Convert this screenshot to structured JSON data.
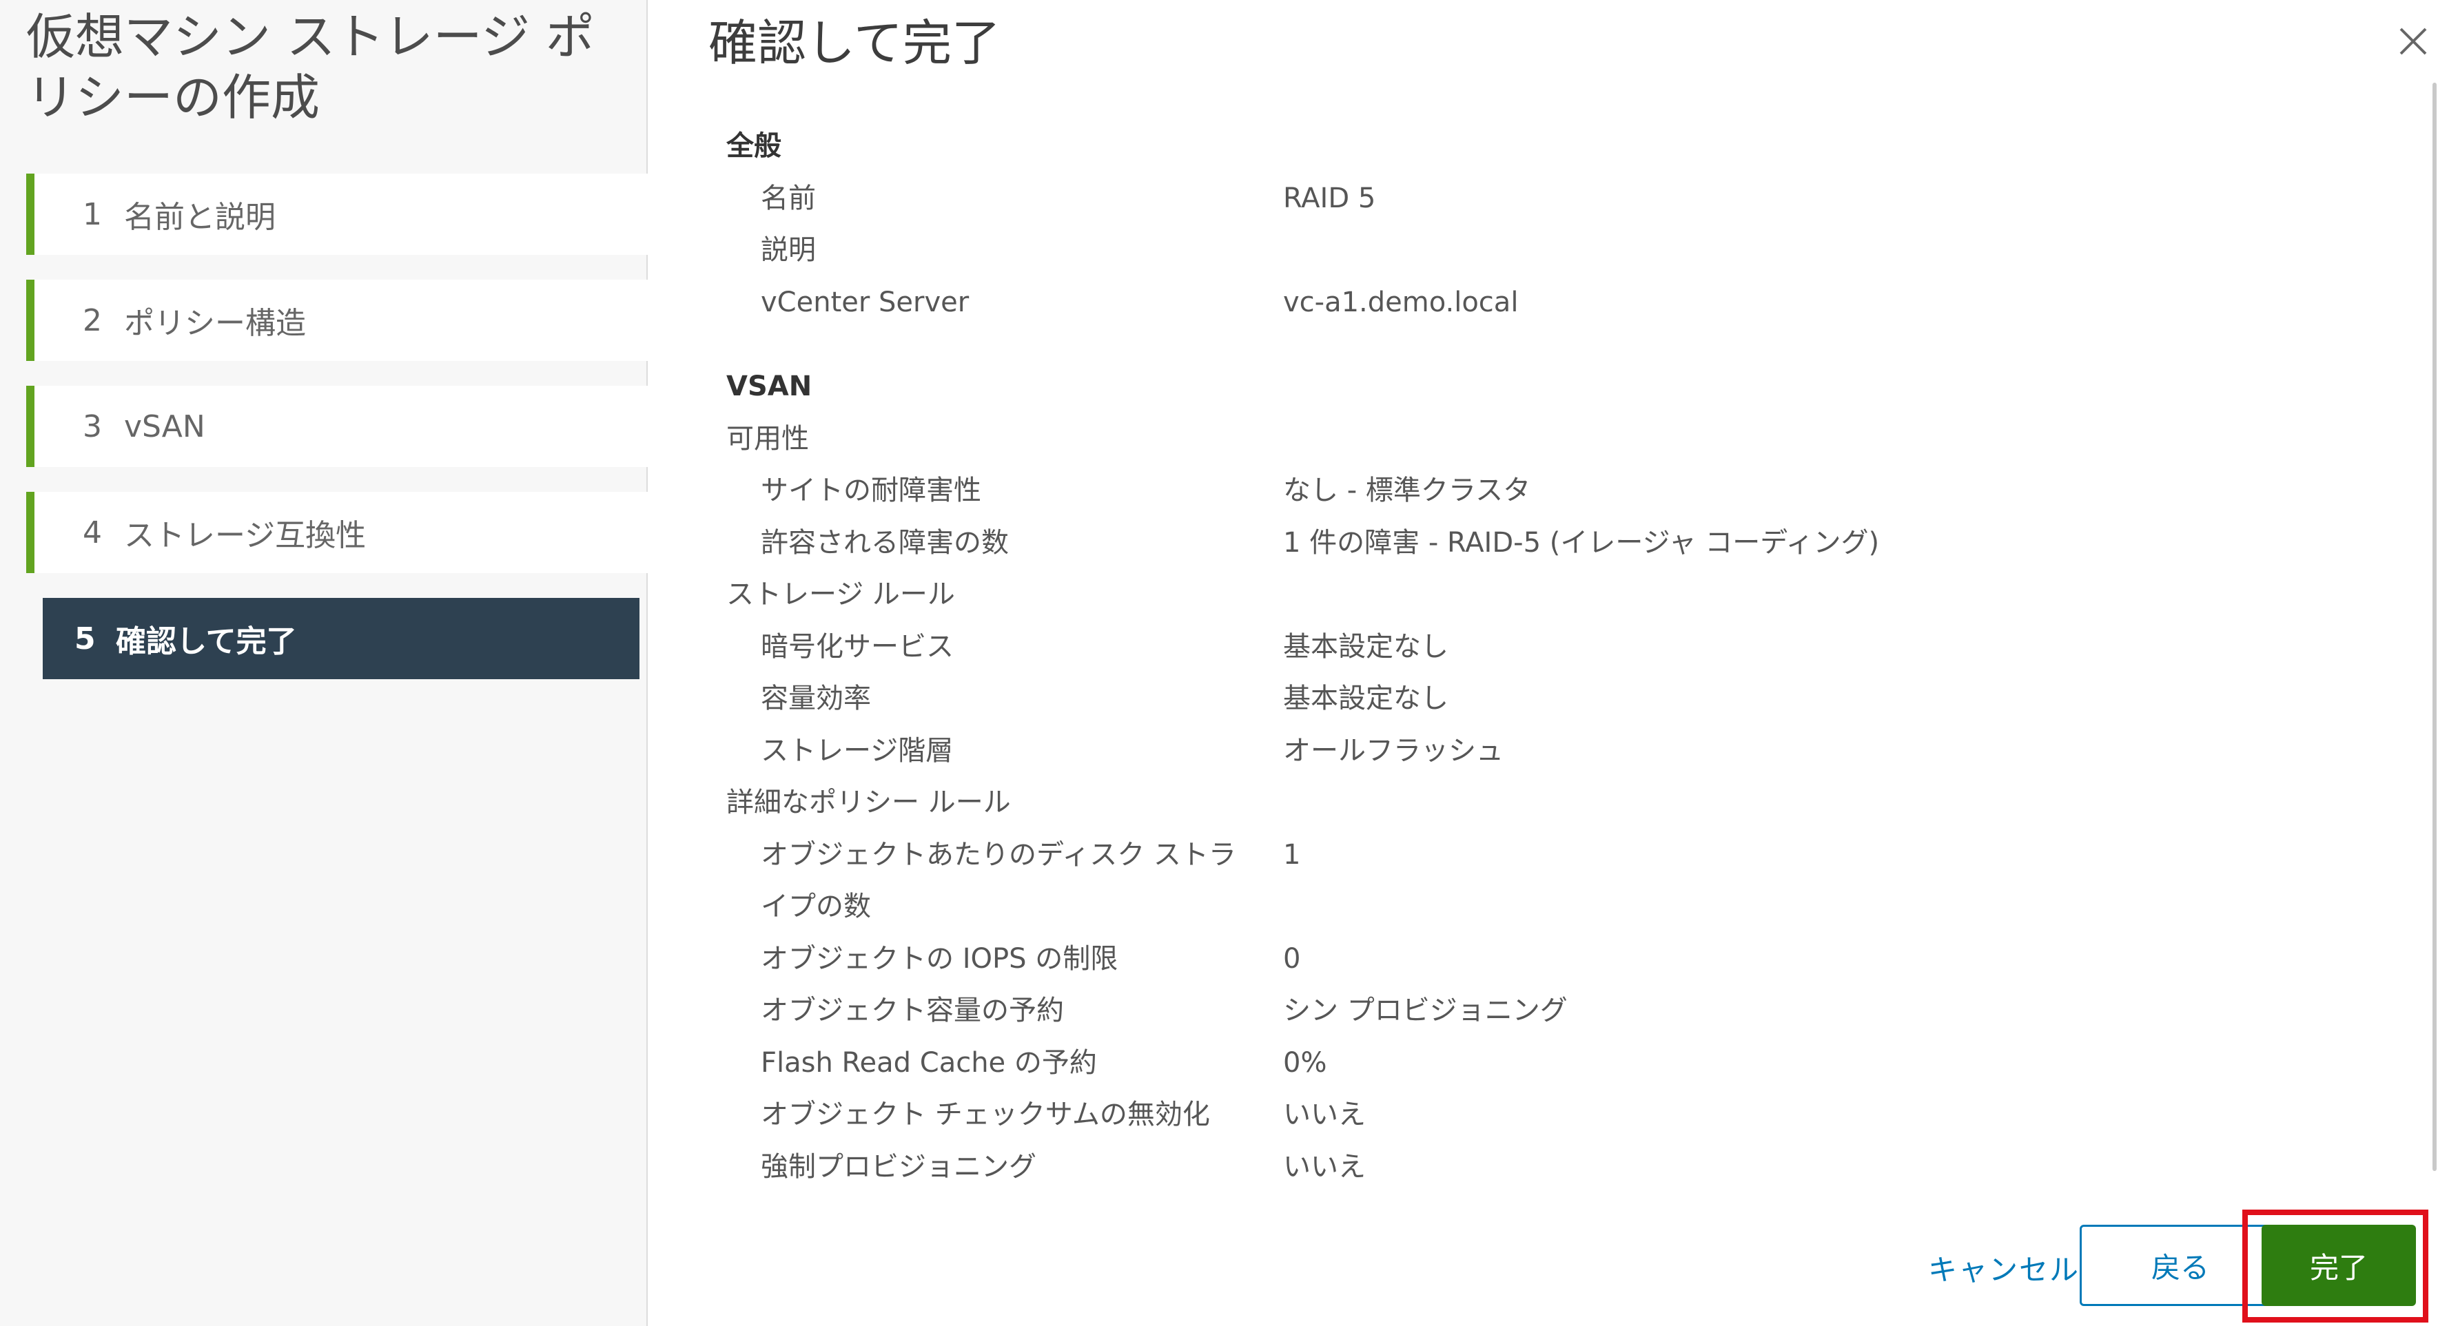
{
  "wizard": {
    "title": "仮想マシン ストレージ ポリシーの作成",
    "steps": [
      {
        "num": "1",
        "label": "名前と説明"
      },
      {
        "num": "2",
        "label": "ポリシー構造"
      },
      {
        "num": "3",
        "label": "vSAN"
      },
      {
        "num": "4",
        "label": "ストレージ互換性"
      },
      {
        "num": "5",
        "label": "確認して完了"
      }
    ],
    "active_step": 5
  },
  "main": {
    "title": "確認して完了",
    "general": {
      "heading": "全般",
      "rows": [
        {
          "label": "名前",
          "value": "RAID 5"
        },
        {
          "label": "説明",
          "value": ""
        },
        {
          "label": "vCenter Server",
          "value": "vc-a1.demo.local"
        }
      ]
    },
    "vsan": {
      "heading": "VSAN",
      "availability": {
        "heading": "可用性",
        "rows": [
          {
            "label": "サイトの耐障害性",
            "value": "なし - 標準クラスタ"
          },
          {
            "label": "許容される障害の数",
            "value": "1 件の障害 - RAID-5 (イレージャ コーディング)"
          }
        ]
      },
      "storage_rules": {
        "heading": "ストレージ ルール",
        "rows": [
          {
            "label": "暗号化サービス",
            "value": "基本設定なし"
          },
          {
            "label": "容量効率",
            "value": "基本設定なし"
          },
          {
            "label": "ストレージ階層",
            "value": "オールフラッシュ"
          }
        ]
      },
      "advanced_rules": {
        "heading": "詳細なポリシー ルール",
        "rows": [
          {
            "label": "オブジェクトあたりのディスク ストラ",
            "value": "1"
          },
          {
            "label": "イプの数",
            "value": ""
          },
          {
            "label": "オブジェクトの IOPS の制限",
            "value": "0"
          },
          {
            "label": "オブジェクト容量の予約",
            "value": "シン プロビジョニング"
          },
          {
            "label": "Flash Read Cache の予約",
            "value": "0%"
          },
          {
            "label": "オブジェクト チェックサムの無効化",
            "value": "いいえ"
          },
          {
            "label": "強制プロビジョニング",
            "value": "いいえ"
          }
        ]
      }
    }
  },
  "footer": {
    "cancel_label": "キャンセル",
    "back_label": "戻る",
    "finish_label": "完了"
  },
  "colors": {
    "accent_blue": "#0079b8",
    "finish_green": "#2e7d10",
    "step_bar_green": "#62a420",
    "active_step_bg": "#2e4151",
    "highlight_red": "#e0101b"
  }
}
